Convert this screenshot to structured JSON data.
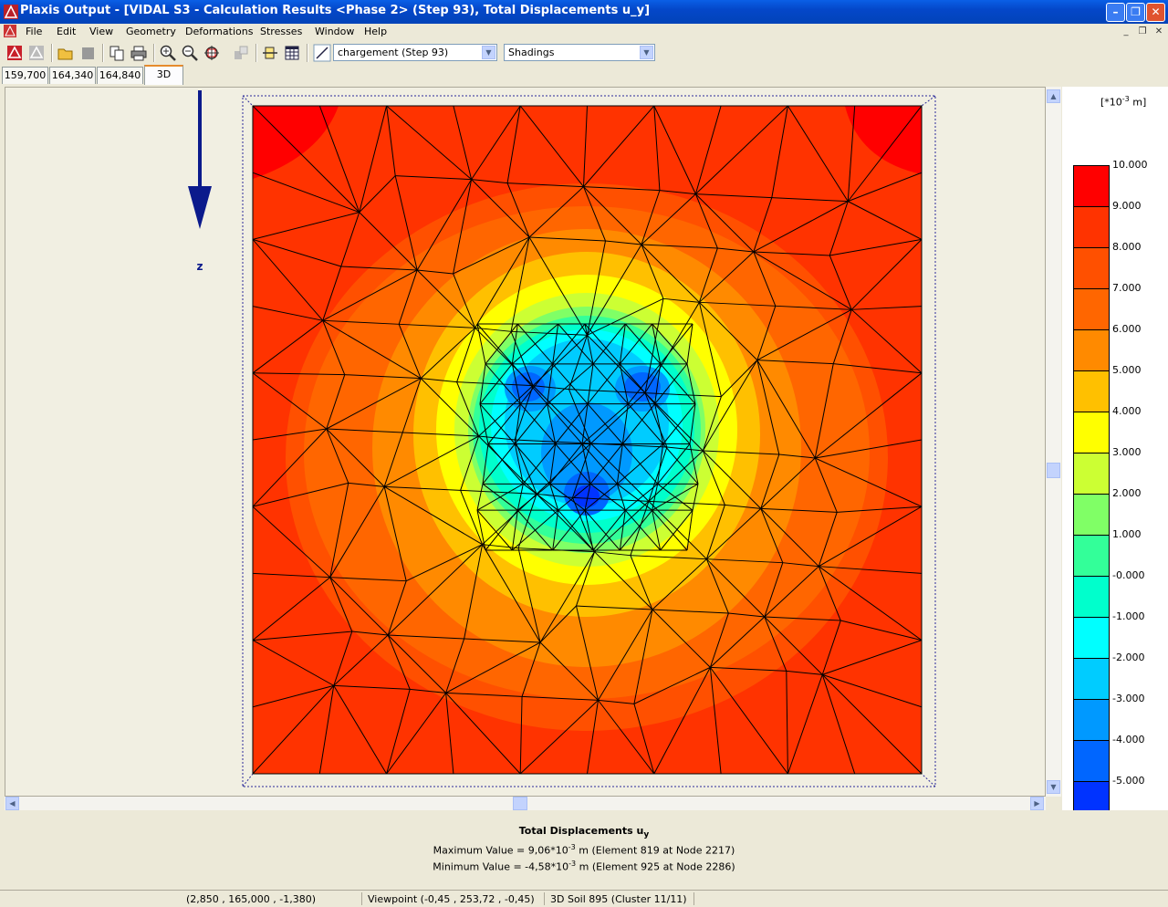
{
  "window": {
    "title": "Plaxis Output - [VIDAL S3 - Calculation Results <Phase 2> (Step 93), Total Displacements u_y]"
  },
  "menu": [
    "File",
    "Edit",
    "View",
    "Geometry",
    "Deformations",
    "Stresses",
    "Window",
    "Help"
  ],
  "toolbar": {
    "step_combo": "chargement (Step 93)",
    "display_combo": "Shadings",
    "icons": [
      "plaxis-input-icon",
      "plaxis-calc-icon",
      "open-icon",
      "save-icon",
      "copy-icon",
      "print-icon",
      "zoom-in-icon",
      "zoom-out-icon",
      "zoom-fit-icon",
      "select-icon",
      "cross-section-icon",
      "table-icon",
      "line-tool-icon"
    ]
  },
  "tabs": [
    "159,700",
    "164,340",
    "164,840",
    "3D"
  ],
  "axis_label": "z",
  "legend": {
    "unit_prefix": "[*10",
    "unit_exp": "-3",
    "unit_suffix": " m]",
    "values": [
      "10.000",
      "9.000",
      "8.000",
      "7.000",
      "6.000",
      "5.000",
      "4.000",
      "3.000",
      "2.000",
      "1.000",
      "-0.000",
      "-1.000",
      "-2.000",
      "-3.000",
      "-4.000",
      "-5.000"
    ],
    "colors": [
      "#ff0000",
      "#ff3300",
      "#ff5000",
      "#ff6600",
      "#ff8a00",
      "#ffc000",
      "#ffff00",
      "#ccff33",
      "#80ff66",
      "#33ff99",
      "#00ffcc",
      "#00ffff",
      "#00ccff",
      "#0099ff",
      "#0066ff",
      "#0033ff"
    ]
  },
  "results": {
    "title": "Total Displacements u",
    "title_sub": "y",
    "max_prefix": "Maximum Value = 9,06*10",
    "max_exp": "-3",
    "max_suffix": " m (Element 819 at Node 2217)",
    "min_prefix": "Minimum Value = -4,58*10",
    "min_exp": "-3",
    "min_suffix": " m (Element 925 at Node 2286)"
  },
  "status": {
    "coords": "(2,850 , 165,000 , -1,380)",
    "viewpoint": "Viewpoint (-0,45 , 253,72 , -0,45)",
    "element": "3D Soil 895 (Cluster 11/11)"
  }
}
